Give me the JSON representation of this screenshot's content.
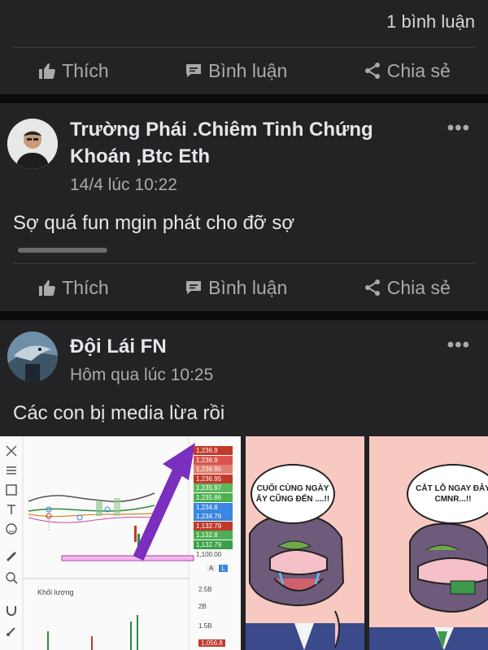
{
  "post0": {
    "comment_count": "1 bình luận",
    "actions": {
      "like": "Thích",
      "comment": "Bình luận",
      "share": "Chia sẻ"
    }
  },
  "post1": {
    "author_line1": "Trường Phái .Chiêm Tinh Chứng",
    "author_line2": "Khoán ,Btc Eth",
    "time": "14/4 lúc 10:22",
    "text": "Sợ quá fun mgin phát cho đỡ sợ",
    "more": "•••",
    "actions": {
      "like": "Thích",
      "comment": "Bình luận",
      "share": "Chia sẻ"
    }
  },
  "post2": {
    "author": "Đội Lái FN",
    "time": "Hôm qua lúc 10:25",
    "text": "Các con bị media lừa rồi",
    "more": "•••",
    "chart": {
      "volume_label": "Khối lượng",
      "price_labels": [
        "1,236.9",
        "1,236.9",
        "1,236.95",
        "1,236.95",
        "1,235.97",
        "1,235.86",
        "1,234.8",
        "1,234.76",
        "1,132.79",
        "1,132.8",
        "1,132.79",
        "1,100.00"
      ],
      "price_colors": [
        "#c0392b",
        "#d9534f",
        "#e08070",
        "#c0392b",
        "#5cb85c",
        "#4caf50",
        "#3a86e0",
        "#3a86e0",
        "#c0392b",
        "#4caf50",
        "#3aa04a",
        "#888888"
      ],
      "volume_ticks": [
        "2.5B",
        "2B",
        "1.5B"
      ],
      "bottom_badge": "1,056.8",
      "buttons": [
        "A",
        "L"
      ]
    },
    "comic": {
      "bubble1": "CUỐI CÙNG NGÀY ẤY CŨNG ĐẾN ....!!",
      "bubble2": "CẮT LỖ NGAY ĐÂY CMNR...!!"
    }
  },
  "colors": {
    "card_bg": "#232325",
    "page_bg": "#111112",
    "muted_text": "#a8aaae",
    "arrow": "#7b2fbf"
  }
}
